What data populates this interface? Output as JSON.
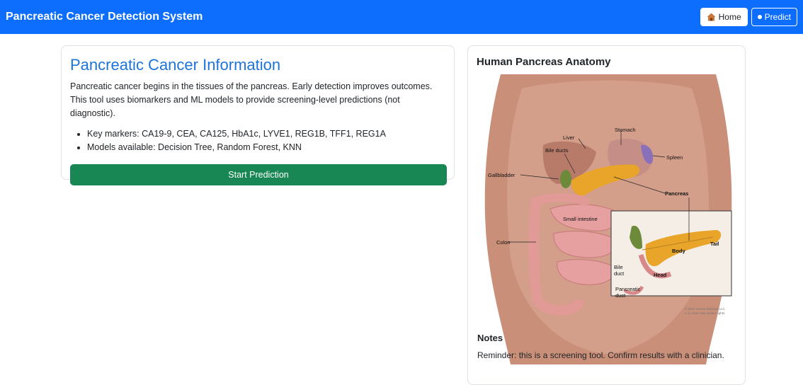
{
  "navbar": {
    "brand": "Pancreatic Cancer Detection System",
    "home_label": "Home",
    "predict_label": "Predict"
  },
  "info": {
    "title": "Pancreatic Cancer Information",
    "description": "Pancreatic cancer begins in the tissues of the pancreas. Early detection improves outcomes. This tool uses biomarkers and ML models to provide screening-level predictions (not diagnostic).",
    "bullets": [
      "Key markers: CA19-9, CEA, CA125, HbA1c, LYVE1, REG1B, TFF1, REG1A",
      "Models available: Decision Tree, Random Forest, KNN"
    ],
    "button_label": "Start Prediction"
  },
  "anatomy": {
    "title": "Human Pancreas Anatomy",
    "labels": {
      "liver": "Liver",
      "stomach": "Stomach",
      "bile_ducts": "Bile ducts",
      "spleen": "Spleen",
      "gallbladder": "Gallbladder",
      "pancreas": "Pancreas",
      "small_intestine": "Small intestine",
      "colon": "Colon",
      "body": "Body",
      "tail": "Tail",
      "bile_duct_1": "Bile",
      "bile_duct_2": "duct",
      "head": "Head",
      "pancreatic_duct_1": "Pancreatic",
      "pancreatic_duct_2": "duct",
      "copyright_1": "© 2023 Terese Winslow LLC",
      "copyright_2": "U.S. Govt. has certain rights"
    }
  },
  "notes": {
    "title": "Notes",
    "text": "Reminder: this is a screening tool. Confirm results with a clinician."
  },
  "colors": {
    "navbar": "#0d6efd",
    "title_blue": "#1d74d8",
    "button_green": "#198754"
  }
}
